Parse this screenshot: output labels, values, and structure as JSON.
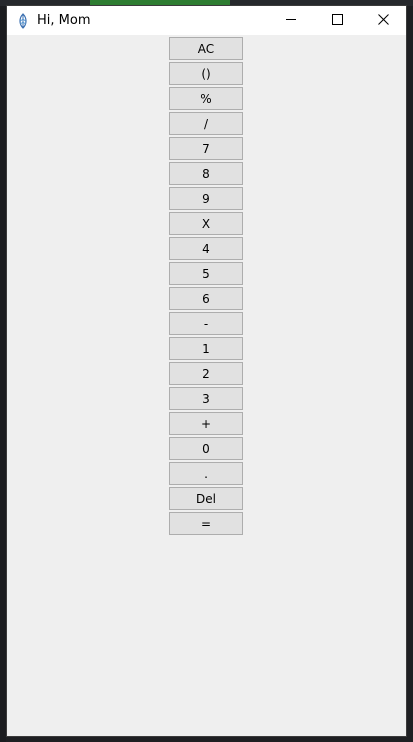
{
  "window": {
    "title": "Hi, Mom"
  },
  "icons": {
    "app": "feather-icon",
    "minimize": "minimize-icon",
    "maximize": "maximize-icon",
    "close": "close-icon"
  },
  "buttons": [
    {
      "label": "AC"
    },
    {
      "label": "()"
    },
    {
      "label": "%"
    },
    {
      "label": "/"
    },
    {
      "label": "7"
    },
    {
      "label": "8"
    },
    {
      "label": "9"
    },
    {
      "label": "X"
    },
    {
      "label": "4"
    },
    {
      "label": "5"
    },
    {
      "label": "6"
    },
    {
      "label": "-"
    },
    {
      "label": "1"
    },
    {
      "label": "2"
    },
    {
      "label": "3"
    },
    {
      "label": "+"
    },
    {
      "label": "0"
    },
    {
      "label": "."
    },
    {
      "label": "Del"
    },
    {
      "label": "="
    }
  ]
}
